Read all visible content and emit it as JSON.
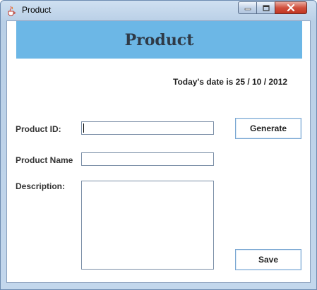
{
  "window": {
    "title": "Product"
  },
  "banner": {
    "title": "Product",
    "color": "#6cb7e6"
  },
  "date_text": "Today's date is 25 / 10 / 2012",
  "form": {
    "product_id_label": "Product ID:",
    "product_id_value": "",
    "product_name_label": "Product Name",
    "product_name_value": "",
    "description_label": "Description:",
    "description_value": ""
  },
  "buttons": {
    "generate": "Generate",
    "save": "Save"
  },
  "icons": {
    "app": "java-cup-icon",
    "minimize": "minimize-icon",
    "maximize": "maximize-icon",
    "close": "close-icon"
  }
}
